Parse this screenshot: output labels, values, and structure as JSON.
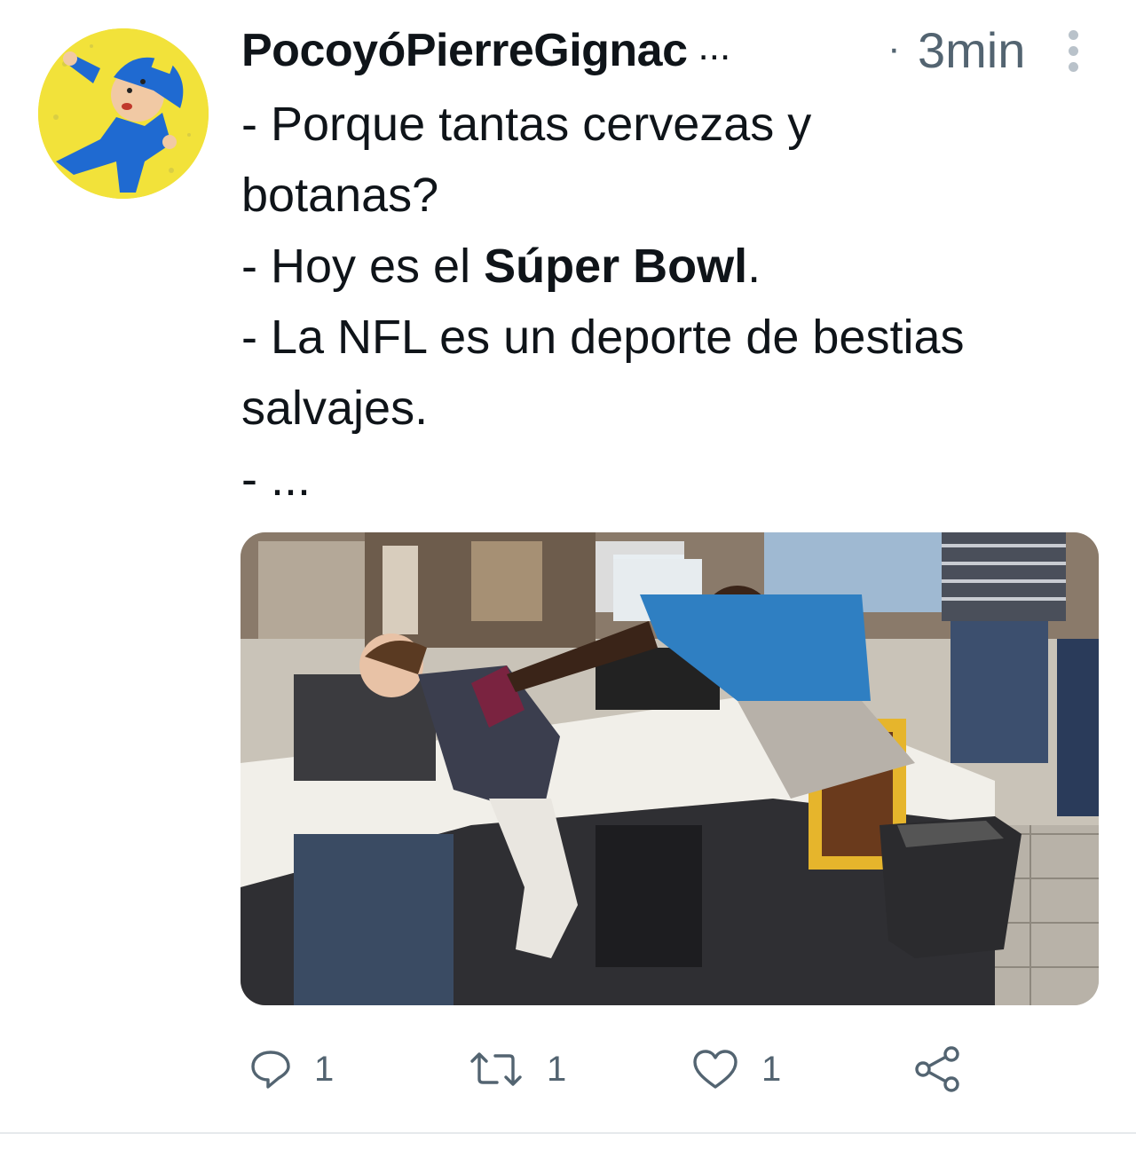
{
  "tweet": {
    "author": {
      "display_name": "PocoyóPierreGignac",
      "name_truncation": "...",
      "avatar_icon": "pocoyo-character-icon"
    },
    "separator": "·",
    "timestamp": "3min",
    "more_icon": "more-vertical-icon",
    "text": {
      "line1": "- Porque tantas cervezas y",
      "line2": "botanas?",
      "line3_prefix": "- Hoy es el ",
      "line3_bold": "Súper Bowl",
      "line3_suffix": ".",
      "line4": "- La NFL es un deporte de bestias",
      "line5": "salvajes.",
      "line6": "- ..."
    },
    "media": {
      "kind": "photo"
    },
    "actions": {
      "reply": {
        "icon": "reply-icon",
        "count": "1"
      },
      "retweet": {
        "icon": "retweet-icon",
        "count": "1"
      },
      "like": {
        "icon": "heart-icon",
        "count": "1"
      },
      "share": {
        "icon": "share-icon"
      }
    },
    "colors": {
      "text": "#0f1419",
      "secondary": "#536471",
      "avatar_bg": "#f2e23a"
    }
  }
}
